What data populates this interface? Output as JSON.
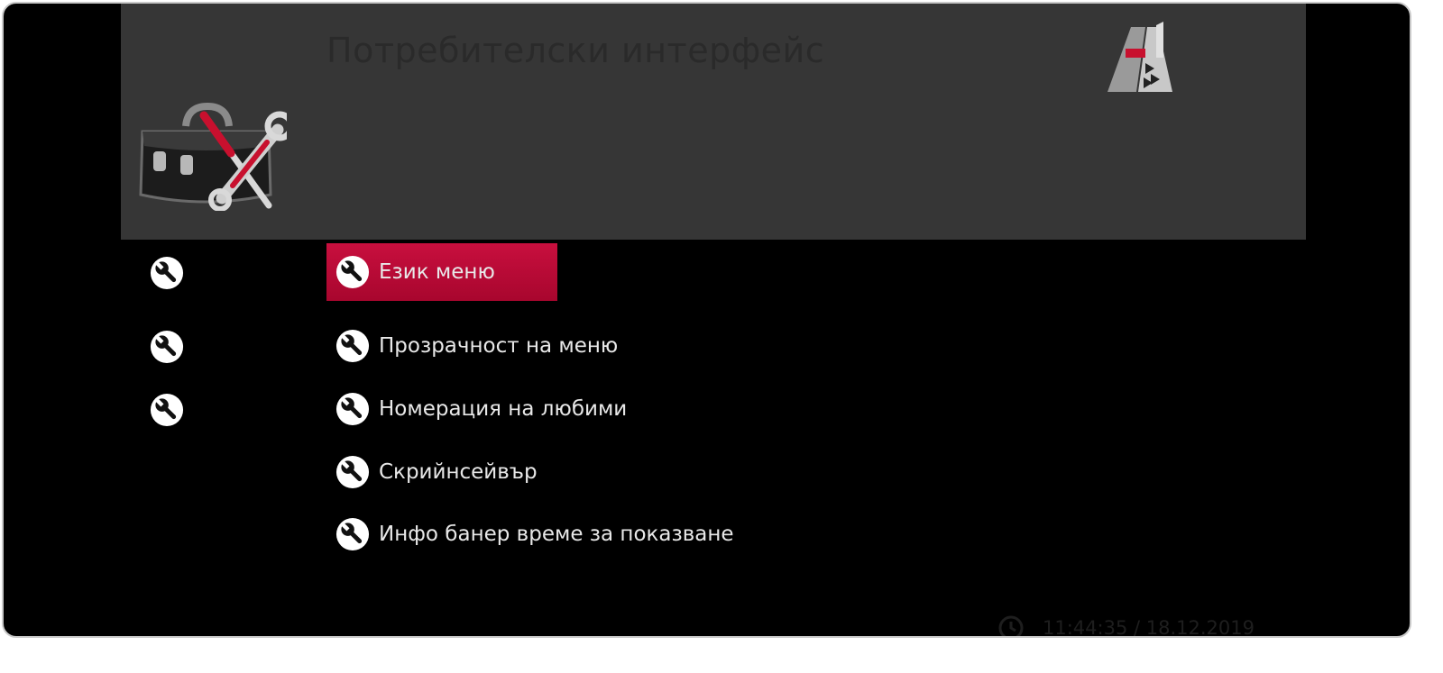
{
  "header": {
    "title": "Потребителски интерфейс",
    "icon": "toolbox-icon",
    "logo": "a1-logo"
  },
  "colors": {
    "background": "#000000",
    "header_panel": "#363636",
    "selection": "#b80a36",
    "text": "#e8e8e8"
  },
  "sidebar": {
    "icons": [
      "wrench-icon",
      "wrench-icon",
      "wrench-icon"
    ]
  },
  "menu": {
    "selected_index": 0,
    "items": [
      {
        "label": "Език меню",
        "icon": "wrench-icon"
      },
      {
        "label": "Прозрачност на меню",
        "icon": "wrench-icon"
      },
      {
        "label": "Номерация на любими",
        "icon": "wrench-icon"
      },
      {
        "label": "Скрийнсейвър",
        "icon": "wrench-icon"
      },
      {
        "label": "Инфо банер време за показване",
        "icon": "wrench-icon"
      }
    ]
  },
  "status": {
    "datetime": "11:44:35 / 18.12.2019",
    "icon": "clock-icon"
  }
}
